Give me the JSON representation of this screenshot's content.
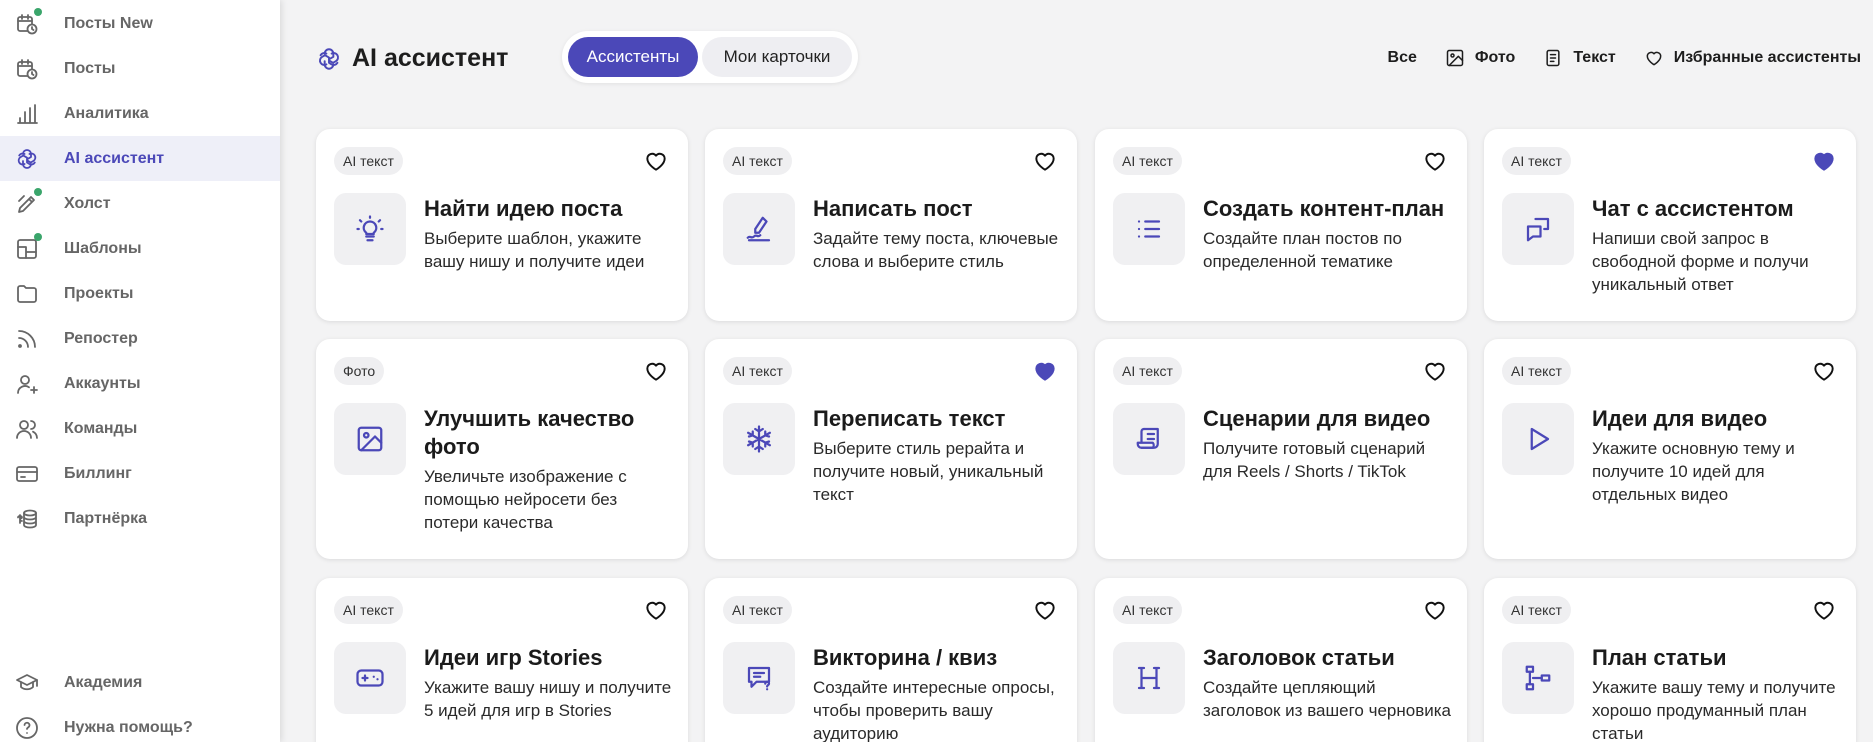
{
  "sidebar": {
    "items": [
      {
        "label": "Посты New",
        "icon": "calendar-clock-icon",
        "dot": true
      },
      {
        "label": "Посты",
        "icon": "calendar-clock-icon",
        "dot": false
      },
      {
        "label": "Аналитика",
        "icon": "bar-chart-icon",
        "dot": false
      },
      {
        "label": "AI ассистент",
        "icon": "ai-spiral-icon",
        "dot": false,
        "active": true
      },
      {
        "label": "Холст",
        "icon": "canvas-pen-icon",
        "dot": true
      },
      {
        "label": "Шаблоны",
        "icon": "template-icon",
        "dot": true
      },
      {
        "label": "Проекты",
        "icon": "folder-icon",
        "dot": false
      },
      {
        "label": "Репостер",
        "icon": "rss-icon",
        "dot": false
      },
      {
        "label": "Аккаунты",
        "icon": "user-add-icon",
        "dot": false
      },
      {
        "label": "Команды",
        "icon": "users-icon",
        "dot": false
      },
      {
        "label": "Биллинг",
        "icon": "credit-card-icon",
        "dot": false
      },
      {
        "label": "Партнёрка",
        "icon": "coins-icon",
        "dot": false
      }
    ],
    "bottom": [
      {
        "label": "Академия",
        "icon": "graduation-cap-icon"
      },
      {
        "label": "Нужна помощь?",
        "icon": "help-circle-icon"
      }
    ]
  },
  "header": {
    "title": "AI ассистент",
    "tabs": [
      "Ассистенты",
      "Мои карточки"
    ],
    "filters": [
      {
        "label": "Все",
        "icon": ""
      },
      {
        "label": "Фото",
        "icon": "image-icon"
      },
      {
        "label": "Текст",
        "icon": "document-icon"
      },
      {
        "label": "Избранные ассистенты",
        "icon": "heart-icon"
      }
    ]
  },
  "colors": {
    "accent": "#4b48b8",
    "dot": "#3aa56b"
  },
  "cards": [
    {
      "badge": "AI текст",
      "title": "Найти идею поста",
      "desc": "Выберите шаблон, укажите вашу нишу и получите идеи",
      "icon": "lightbulb-icon",
      "favorite": false
    },
    {
      "badge": "AI текст",
      "title": "Написать пост",
      "desc": "Задайте тему поста, ключевые слова и выберите стиль",
      "icon": "pen-write-icon",
      "favorite": false
    },
    {
      "badge": "AI текст",
      "title": "Создать контент-план",
      "desc": "Создайте план постов по определенной тематике",
      "icon": "list-icon",
      "favorite": false
    },
    {
      "badge": "AI текст",
      "title": "Чат с ассистентом",
      "desc": "Напиши свой запрос в свободной форме и получи уникальный ответ",
      "icon": "chat-icon",
      "favorite": true
    },
    {
      "badge": "Фото",
      "title": "Улучшить качество фото",
      "desc": "Увеличьте изображение с помощью нейросети без потери качества",
      "icon": "image-icon",
      "favorite": false
    },
    {
      "badge": "AI текст",
      "title": "Переписать текст",
      "desc": "Выберите стиль рерайта и получите новый, уникальный текст",
      "icon": "snowflake-icon",
      "favorite": true
    },
    {
      "badge": "AI текст",
      "title": "Сценарии для видео",
      "desc": "Получите готовый сценарий для Reels / Shorts / TikTok",
      "icon": "script-icon",
      "favorite": false
    },
    {
      "badge": "AI текст",
      "title": "Идеи для видео",
      "desc": "Укажите основную тему и получите 10 идей для отдельных видео",
      "icon": "play-icon",
      "favorite": false
    },
    {
      "badge": "AI текст",
      "title": "Идеи игр Stories",
      "desc": "Укажите вашу нишу и получите 5 идей для игр в Stories",
      "icon": "gamepad-icon",
      "favorite": false
    },
    {
      "badge": "AI текст",
      "title": "Викторина / квиз",
      "desc": "Создайте интересные опросы, чтобы проверить вашу аудиторию",
      "icon": "quiz-icon",
      "favorite": false
    },
    {
      "badge": "AI текст",
      "title": "Заголовок статьи",
      "desc": "Создайте цепляющий заголовок из вашего черновика",
      "icon": "heading-icon",
      "favorite": false
    },
    {
      "badge": "AI текст",
      "title": "План статьи",
      "desc": "Укажите вашу тему и получите хорошо продуманный план статьи",
      "icon": "outline-tree-icon",
      "favorite": false
    }
  ]
}
